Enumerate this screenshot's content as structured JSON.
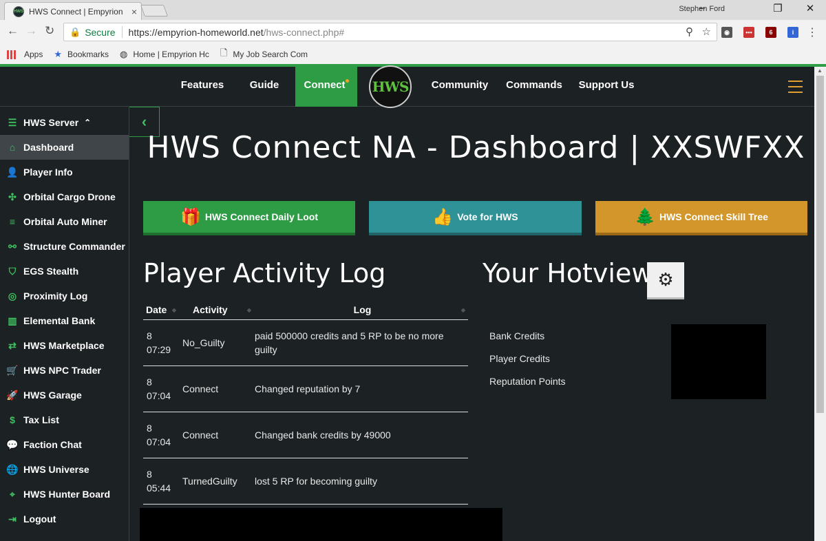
{
  "browser": {
    "tab_title": "HWS Connect | Empyrion",
    "tab_close": "×",
    "profile_name": "Stephen Ford",
    "secure_label": "Secure",
    "url_host": "https://empyrion-homeworld.net",
    "url_path": "/hws-connect.php#",
    "bookmarks": [
      {
        "label": "Apps",
        "icon": "apps-grid-icon"
      },
      {
        "label": "Bookmarks",
        "icon": "star-icon"
      },
      {
        "label": "Home | Empyrion Hc",
        "icon": "hws-favicon"
      },
      {
        "label": "My Job Search Com",
        "icon": "page-icon"
      }
    ],
    "extension_badge": "6"
  },
  "nav": {
    "items": [
      "Features",
      "Guide",
      "Connect",
      "Community",
      "Commands",
      "Support Us"
    ],
    "active": "Connect",
    "logo_text": "HWS",
    "accent": "#2e9b45"
  },
  "sidebar": {
    "header": "HWS Server",
    "items": [
      {
        "label": "Dashboard",
        "icon": "home-icon",
        "active": true
      },
      {
        "label": "Player Info",
        "icon": "user-icon"
      },
      {
        "label": "Orbital Cargo Drone",
        "icon": "drone-icon"
      },
      {
        "label": "Orbital Auto Miner",
        "icon": "database-icon"
      },
      {
        "label": "Structure Commander",
        "icon": "nodes-icon"
      },
      {
        "label": "EGS Stealth",
        "icon": "shield-icon"
      },
      {
        "label": "Proximity Log",
        "icon": "radar-icon"
      },
      {
        "label": "Elemental Bank",
        "icon": "building-icon"
      },
      {
        "label": "HWS Marketplace",
        "icon": "exchange-icon"
      },
      {
        "label": "HWS NPC Trader",
        "icon": "basket-icon"
      },
      {
        "label": "HWS Garage",
        "icon": "rocket-icon"
      },
      {
        "label": "Tax List",
        "icon": "money-icon"
      },
      {
        "label": "Faction Chat",
        "icon": "chat-icon"
      },
      {
        "label": "HWS Universe",
        "icon": "globe-icon"
      },
      {
        "label": "HWS Hunter Board",
        "icon": "crosshair-icon"
      },
      {
        "label": "Logout",
        "icon": "logout-icon"
      }
    ]
  },
  "page_title": "HWS Connect NA - Dashboard | XXSWFXX",
  "buttons": {
    "daily_loot": "HWS Connect Daily Loot",
    "vote": "Vote for HWS",
    "skill_tree": "HWS Connect Skill Tree"
  },
  "activity": {
    "title": "Player Activity Log",
    "columns": [
      "Date",
      "Activity",
      "Log"
    ],
    "rows": [
      {
        "day": "8",
        "time": "07:29",
        "activity": "No_Guilty",
        "log": "paid 500000 credits and 5 RP to be no more guilty"
      },
      {
        "day": "8",
        "time": "07:04",
        "activity": "Connect",
        "log": "Changed reputation by 7"
      },
      {
        "day": "8",
        "time": "07:04",
        "activity": "Connect",
        "log": "Changed bank credits by 49000"
      },
      {
        "day": "8",
        "time": "05:44",
        "activity": "TurnedGuilty",
        "log": "lost 5 RP for becoming guilty"
      }
    ]
  },
  "hotview": {
    "title": "Your Hotview",
    "labels": [
      "Bank Credits",
      "Player Credits",
      "Reputation Points"
    ]
  }
}
